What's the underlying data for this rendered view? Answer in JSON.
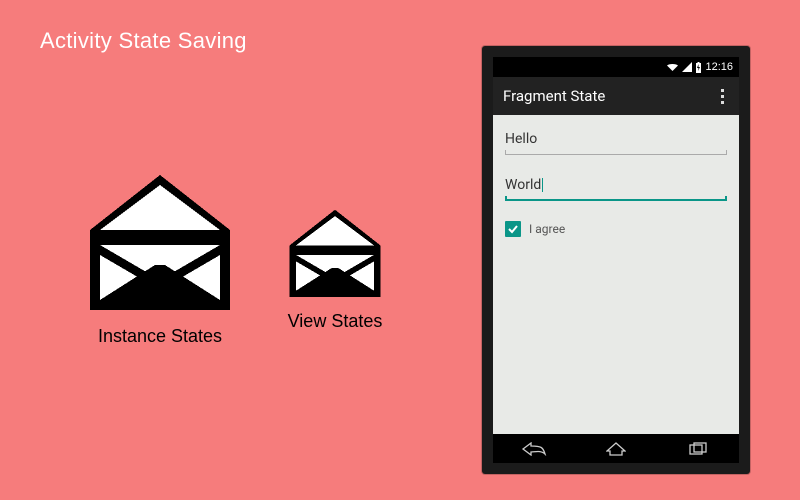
{
  "title": "Activity State Saving",
  "envelopes": {
    "instance_label": "Instance States",
    "view_label": "View States"
  },
  "phone": {
    "statusbar": {
      "time": "12:16"
    },
    "actionbar": {
      "title": "Fragment State"
    },
    "fields": {
      "field1_value": "Hello",
      "field2_value": "World"
    },
    "checkbox": {
      "label": "I agree",
      "checked": true
    }
  }
}
